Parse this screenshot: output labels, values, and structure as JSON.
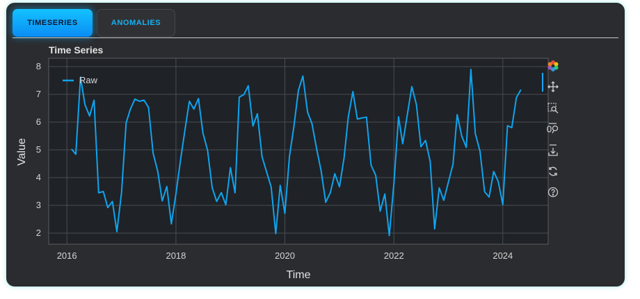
{
  "tabs": [
    {
      "label": "TIMESERIES",
      "active": true
    },
    {
      "label": "ANOMALIES",
      "active": false
    }
  ],
  "plot": {
    "title": "Time Series"
  },
  "toolbar": {
    "items": [
      {
        "name": "bokeh-logo-icon"
      },
      {
        "name": "pan-icon"
      },
      {
        "name": "box-zoom-icon"
      },
      {
        "name": "wheel-zoom-icon"
      },
      {
        "name": "save-icon"
      },
      {
        "name": "reset-icon"
      },
      {
        "name": "help-icon"
      }
    ]
  },
  "colors": {
    "background": "#2b2c2f",
    "plot_bg": "#1f2227",
    "accent": "#12b0f5",
    "line": "#0fa4ee",
    "grid": "#4a4d52"
  },
  "chart_data": {
    "type": "line",
    "xlabel": "Time",
    "ylabel": "Value",
    "x_ticks": [
      "2016",
      "2018",
      "2020",
      "2022",
      "2024"
    ],
    "y_ticks": [
      "2",
      "3",
      "4",
      "5",
      "6",
      "7",
      "8"
    ],
    "xlim": [
      "2015-09-01",
      "2024-10-31"
    ],
    "ylim": [
      1.6,
      8.3
    ],
    "grid": true,
    "legend_position": "top-left",
    "series": [
      {
        "name": "Raw",
        "x": [
          "2016-02",
          "2016-03",
          "2016-04",
          "2016-05",
          "2016-06",
          "2016-07",
          "2016-08",
          "2016-09",
          "2016-10",
          "2016-11",
          "2016-12",
          "2017-01",
          "2017-02",
          "2017-03",
          "2017-04",
          "2017-05",
          "2017-06",
          "2017-07",
          "2017-08",
          "2017-09",
          "2017-10",
          "2017-11",
          "2017-12",
          "2018-01",
          "2018-02",
          "2018-03",
          "2018-04",
          "2018-05",
          "2018-06",
          "2018-07",
          "2018-08",
          "2018-09",
          "2018-10",
          "2018-11",
          "2018-12",
          "2019-01",
          "2019-02",
          "2019-03",
          "2019-04",
          "2019-05",
          "2019-06",
          "2019-07",
          "2019-08",
          "2019-09",
          "2019-10",
          "2019-11",
          "2019-12",
          "2020-01",
          "2020-02",
          "2020-03",
          "2020-04",
          "2020-05",
          "2020-06",
          "2020-07",
          "2020-08",
          "2020-09",
          "2020-10",
          "2020-11",
          "2020-12",
          "2021-01",
          "2021-02",
          "2021-03",
          "2021-04",
          "2021-05",
          "2021-06",
          "2021-07",
          "2021-08",
          "2021-09",
          "2021-10",
          "2021-11",
          "2021-12",
          "2022-01",
          "2022-02",
          "2022-03",
          "2022-04",
          "2022-05",
          "2022-06",
          "2022-07",
          "2022-08",
          "2022-09",
          "2022-10",
          "2022-11",
          "2022-12",
          "2023-01",
          "2023-02",
          "2023-03",
          "2023-04",
          "2023-05",
          "2023-06",
          "2023-07",
          "2023-08",
          "2023-09",
          "2023-10",
          "2023-11",
          "2023-12",
          "2024-01",
          "2024-02",
          "2024-03",
          "2024-04",
          "2024-05"
        ],
        "y": [
          5.03,
          4.84,
          7.62,
          6.63,
          6.22,
          6.79,
          3.45,
          3.5,
          2.92,
          3.14,
          2.05,
          3.46,
          5.97,
          6.46,
          6.83,
          6.75,
          6.79,
          6.53,
          4.88,
          4.22,
          3.16,
          3.68,
          2.33,
          3.41,
          4.65,
          5.67,
          6.75,
          6.47,
          6.85,
          5.61,
          4.98,
          3.64,
          3.14,
          3.46,
          3.02,
          4.36,
          3.45,
          6.9,
          6.99,
          7.31,
          5.86,
          6.3,
          4.75,
          4.2,
          3.66,
          1.98,
          3.72,
          2.71,
          4.76,
          5.83,
          7.15,
          7.66,
          6.36,
          5.94,
          5.03,
          4.22,
          3.11,
          3.46,
          4.14,
          3.67,
          4.71,
          6.18,
          7.1,
          6.11,
          6.15,
          6.18,
          4.45,
          4.08,
          2.79,
          3.41,
          1.91,
          3.81,
          6.19,
          5.22,
          6.28,
          7.28,
          6.63,
          5.11,
          5.34,
          4.58,
          2.15,
          3.63,
          3.18,
          3.83,
          4.48,
          6.27,
          5.49,
          5.09,
          7.9,
          5.58,
          4.95,
          3.49,
          3.3,
          4.22,
          3.86,
          3.03,
          5.87,
          5.8,
          6.88,
          7.17
        ]
      }
    ]
  }
}
